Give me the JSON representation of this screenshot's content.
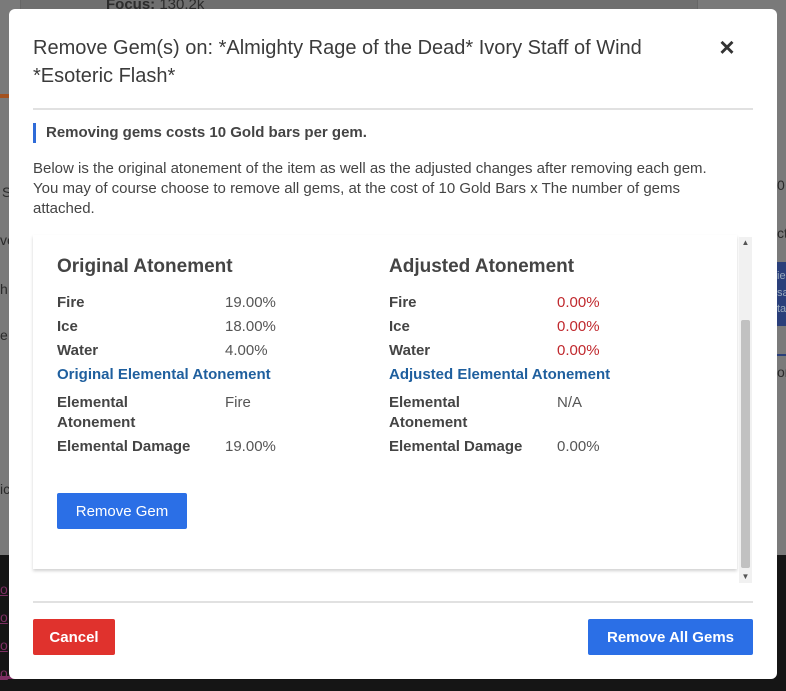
{
  "background": {
    "focus_label": "Focus:",
    "focus_value": "130.2k",
    "side_fragments": [
      "S",
      "ve",
      "h",
      "e",
      "ic"
    ],
    "right_fragments": [
      "0",
      "ct",
      "ie",
      "sa",
      "ta",
      "ort"
    ],
    "bottom_links": [
      "o",
      "o",
      "o",
      "o"
    ]
  },
  "modal": {
    "title": "Remove Gem(s) on: *Almighty Rage of the Dead* Ivory Staff of Wind *Esoteric Flash*",
    "close_icon": "×",
    "notice": "Removing gems costs 10 Gold bars per gem.",
    "description": "Below is the original atonement of the item as well as the adjusted changes after removing each gem. You may of course choose to remove all gems, at the cost of 10 Gold Bars x The number of gems attached.",
    "original": {
      "heading": "Original Atonement",
      "rows": [
        {
          "label": "Fire",
          "value": "19.00%"
        },
        {
          "label": "Ice",
          "value": "18.00%"
        },
        {
          "label": "Water",
          "value": "4.00%"
        }
      ],
      "elemental_heading": "Original Elemental Atonement",
      "elemental_rows": [
        {
          "label": "Elemental Atonement",
          "value": "Fire"
        },
        {
          "label": "Elemental Damage",
          "value": "19.00%"
        }
      ]
    },
    "adjusted": {
      "heading": "Adjusted Atonement",
      "rows": [
        {
          "label": "Fire",
          "value": "0.00%"
        },
        {
          "label": "Ice",
          "value": "0.00%"
        },
        {
          "label": "Water",
          "value": "0.00%"
        }
      ],
      "elemental_heading": "Adjusted Elemental Atonement",
      "elemental_rows": [
        {
          "label": "Elemental Atonement",
          "value": "N/A"
        },
        {
          "label": "Elemental Damage",
          "value": "0.00%"
        }
      ]
    },
    "remove_gem_label": "Remove Gem",
    "cancel_label": "Cancel",
    "remove_all_label": "Remove All Gems",
    "colors": {
      "primary": "#2b6fe6",
      "danger": "#e0322d",
      "negative_value": "#c0282d",
      "subheading": "#1f5f9e"
    }
  }
}
